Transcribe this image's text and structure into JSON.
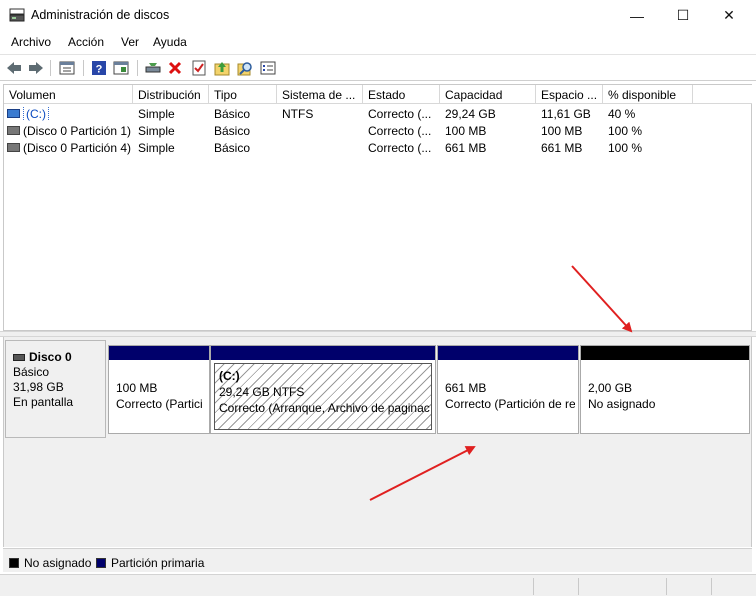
{
  "window": {
    "title": "Administración de discos",
    "controls": {
      "minimize": "—",
      "maximize": "☐",
      "close": "✕"
    }
  },
  "menu": [
    "Archivo",
    "Acción",
    "Ver",
    "Ayuda"
  ],
  "toolbar": {
    "icons": [
      "back-arrow-icon",
      "forward-arrow-icon",
      "properties-pane-icon",
      "help-icon",
      "view-icon",
      "connect-drive-icon",
      "delete-icon",
      "check-icon",
      "up-folder-icon",
      "search-icon",
      "list-icon"
    ]
  },
  "volume_list": {
    "columns": [
      "Volumen",
      "Distribución",
      "Tipo",
      "Sistema de ...",
      "Estado",
      "Capacidad",
      "Espacio ...",
      "% disponible"
    ],
    "rows": [
      {
        "volume": "(C:)",
        "layout": "Simple",
        "type": "Básico",
        "fs": "NTFS",
        "status": "Correcto (...",
        "capacity": "29,24 GB",
        "free": "11,61 GB",
        "pct": "40 %"
      },
      {
        "volume": "(Disco 0 Partición 1)",
        "layout": "Simple",
        "type": "Básico",
        "fs": "",
        "status": "Correcto (...",
        "capacity": "100 MB",
        "free": "100 MB",
        "pct": "100 %"
      },
      {
        "volume": "(Disco 0 Partición 4)",
        "layout": "Simple",
        "type": "Básico",
        "fs": "",
        "status": "Correcto (...",
        "capacity": "661 MB",
        "free": "661 MB",
        "pct": "100 %"
      }
    ]
  },
  "disk": {
    "name": "Disco 0",
    "type": "Básico",
    "size": "31,98 GB",
    "state": "En pantalla",
    "partitions": [
      {
        "size": "100 MB",
        "status": "Correcto (Partici"
      },
      {
        "label": "(C:)",
        "size": "29,24 GB NTFS",
        "status": "Correcto (Arranque, Archivo de paginac"
      },
      {
        "size": "661 MB",
        "status": "Correcto (Partición de re"
      },
      {
        "size": "2,00 GB",
        "status": "No asignado"
      }
    ]
  },
  "legend": [
    {
      "label": "No asignado",
      "color": "#000000"
    },
    {
      "label": "Partición primaria",
      "color": "#00006b"
    }
  ],
  "colors": {
    "primary_partition": "#00006b",
    "unallocated": "#000000",
    "annotation_arrow": "#e02020"
  }
}
